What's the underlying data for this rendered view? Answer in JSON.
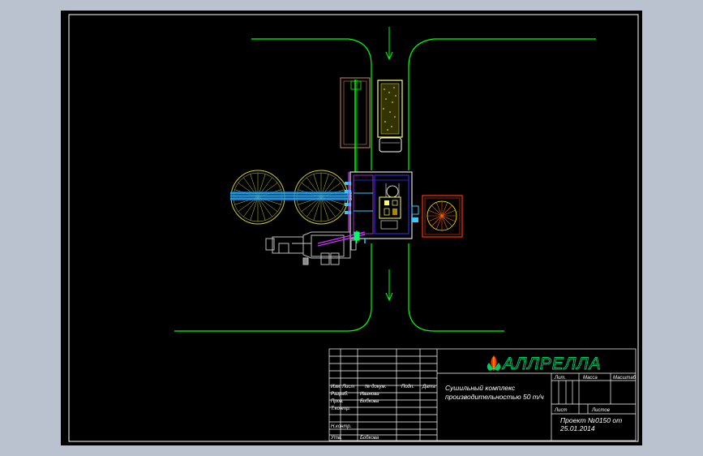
{
  "colors": {
    "background": "#b9c2ce",
    "sheet": "#000000",
    "frame": "#ffffff",
    "road": "#00ff00",
    "equipment_yellow": "#ffff66",
    "conveyor_cyan": "#33aaff",
    "duct_magenta": "#cc33ff",
    "accent_orange": "#ff3300",
    "brand_green": "#00cc66"
  },
  "drawing": {
    "flow_arrows": [
      "flow-arrow-top",
      "flow-arrow-bottom"
    ]
  },
  "title_block": {
    "brand_name": "АЛЛРЕЛЛА",
    "brand_icon": "leaf-grain-icon",
    "description_line1": "Сушильный комплекс",
    "description_line2": "производительностью 50 т/ч",
    "project_line1": "Проект №0150 от",
    "project_line2": "25.01.2014",
    "header_cells": [
      "Изм.",
      "Лист",
      "№ докум.",
      "Подп.",
      "Дата"
    ],
    "sign_rows": [
      {
        "role": "Разраб.",
        "name": "Иванова"
      },
      {
        "role": "Пров.",
        "name": "Бобкова"
      },
      {
        "role": "Т.контр.",
        "name": ""
      },
      {
        "role": "Н.контр.",
        "name": ""
      },
      {
        "role": "Утв.",
        "name": "Бобкова"
      }
    ],
    "right_headers": [
      "Лит.",
      "Масса",
      "Масштаб"
    ],
    "sheet_labels": [
      "Лист",
      "Листов"
    ]
  }
}
